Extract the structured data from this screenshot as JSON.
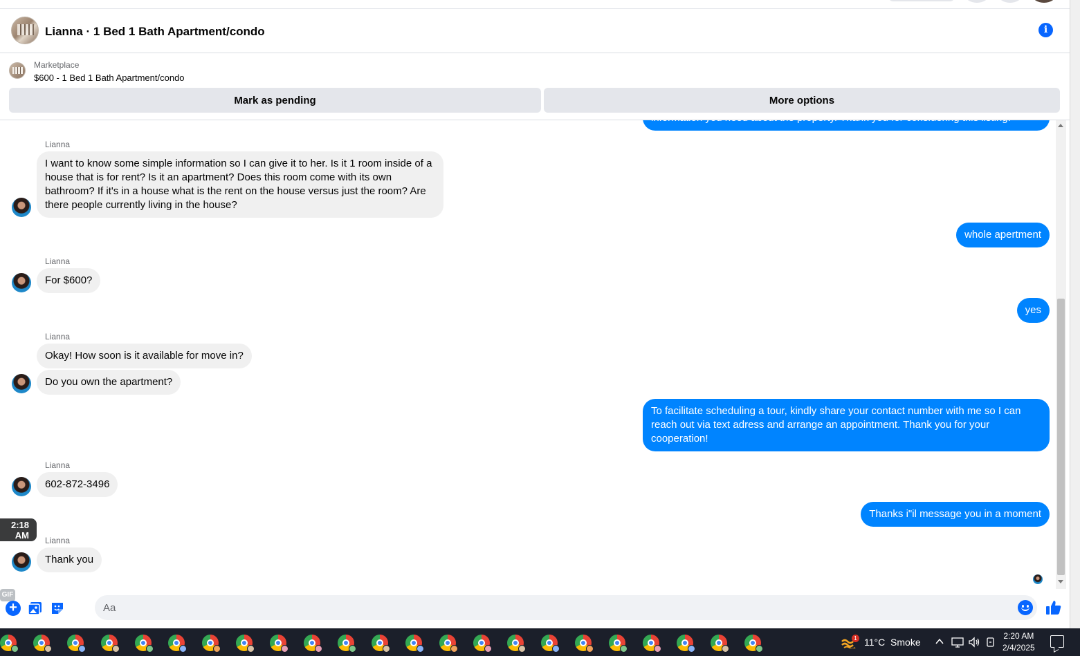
{
  "header": {
    "title": "Lianna · 1 Bed 1 Bath Apartment/condo"
  },
  "marketplace": {
    "label": "Marketplace",
    "listing": "$600 - 1 Bed 1 Bath Apartment/condo",
    "buttons": {
      "mark_pending": "Mark as pending",
      "more_options": "More options"
    }
  },
  "conversation": {
    "partial_top_message": "information you need about the property. Thank you for considering this listing.",
    "messages": [
      {
        "from": "Lianna",
        "text": "I want to know some simple information so I can give it to her. Is it 1 room inside of a house that is for rent? Is it an apartment? Does this room come with its own bathroom? If it's in a house what is the rent on the house versus just the room? Are there people currently living in the house?"
      },
      {
        "from": "me",
        "text": "whole apertment"
      },
      {
        "from": "Lianna",
        "text": "For $600?"
      },
      {
        "from": "me",
        "text": "yes"
      },
      {
        "from": "Lianna",
        "text": "Okay! How soon is it available for move in?"
      },
      {
        "from": "Lianna",
        "text": "Do you own the apartment?"
      },
      {
        "from": "me",
        "text": "To facilitate scheduling a tour, kindly share your contact number with me so I can reach out via text adress  and arrange an appointment. Thank you for your cooperation!"
      },
      {
        "from": "Lianna",
        "text": "602-872-3496"
      },
      {
        "from": "me",
        "text": "Thanks i\"il message you in a moment"
      },
      {
        "from": "Lianna",
        "text": "Thank you"
      }
    ],
    "hover_time": "2:18 AM"
  },
  "composer": {
    "placeholder": "Aa",
    "value": "",
    "icons": [
      "plus-icon",
      "photo-icon",
      "sticker-icon",
      "gif-icon",
      "emoji-icon",
      "like-icon"
    ],
    "gif_label": "GIF"
  },
  "taskbar": {
    "app_count": 22,
    "app_icon": "chrome-icon",
    "weather": {
      "notification_count": "1",
      "temperature": "11°C",
      "condition": "Smoke"
    },
    "clock": {
      "time": "2:20 AM",
      "date": "2/4/2025"
    }
  },
  "colors": {
    "accent": "#0866ff",
    "outgoing_bubble": "#0084ff",
    "incoming_bubble": "#f0f0f0",
    "taskbar": "#1b1f2a"
  }
}
